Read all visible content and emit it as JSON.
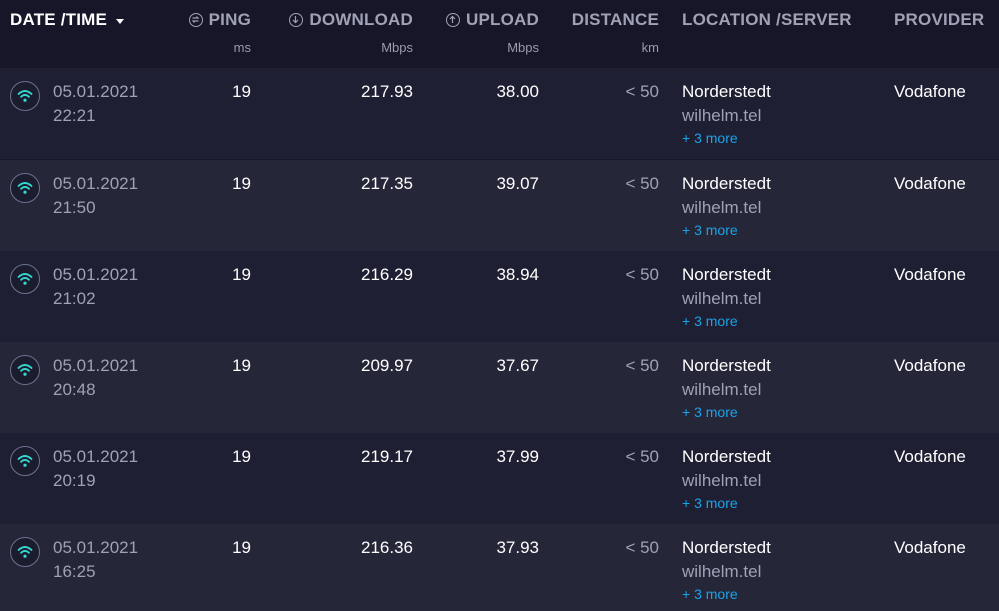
{
  "header": {
    "date_time": "DATE /TIME",
    "ping": "PING",
    "ping_unit": "ms",
    "download": "DOWNLOAD",
    "download_unit": "Mbps",
    "upload": "UPLOAD",
    "upload_unit": "Mbps",
    "distance": "DISTANCE",
    "distance_unit": "km",
    "location": "LOCATION /SERVER",
    "provider": "PROVIDER"
  },
  "rows": [
    {
      "date": "05.01.2021",
      "time": "22:21",
      "ping": "19",
      "download": "217.93",
      "upload": "38.00",
      "distance": "< 50",
      "location": "Norderstedt",
      "server": "wilhelm.tel",
      "more": "+ 3 more",
      "provider": "Vodafone"
    },
    {
      "date": "05.01.2021",
      "time": "21:50",
      "ping": "19",
      "download": "217.35",
      "upload": "39.07",
      "distance": "< 50",
      "location": "Norderstedt",
      "server": "wilhelm.tel",
      "more": "+ 3 more",
      "provider": "Vodafone"
    },
    {
      "date": "05.01.2021",
      "time": "21:02",
      "ping": "19",
      "download": "216.29",
      "upload": "38.94",
      "distance": "< 50",
      "location": "Norderstedt",
      "server": "wilhelm.tel",
      "more": "+ 3 more",
      "provider": "Vodafone"
    },
    {
      "date": "05.01.2021",
      "time": "20:48",
      "ping": "19",
      "download": "209.97",
      "upload": "37.67",
      "distance": "< 50",
      "location": "Norderstedt",
      "server": "wilhelm.tel",
      "more": "+ 3 more",
      "provider": "Vodafone"
    },
    {
      "date": "05.01.2021",
      "time": "20:19",
      "ping": "19",
      "download": "219.17",
      "upload": "37.99",
      "distance": "< 50",
      "location": "Norderstedt",
      "server": "wilhelm.tel",
      "more": "+ 3 more",
      "provider": "Vodafone"
    },
    {
      "date": "05.01.2021",
      "time": "16:25",
      "ping": "19",
      "download": "216.36",
      "upload": "37.93",
      "distance": "< 50",
      "location": "Norderstedt",
      "server": "wilhelm.tel",
      "more": "+ 3 more",
      "provider": "Vodafone"
    }
  ],
  "icons": {
    "connection": "wifi-icon",
    "ping": "ping-icon",
    "download": "download-icon",
    "upload": "upload-icon",
    "sort": "caret-down-icon"
  },
  "colors": {
    "background": "#161628",
    "row_odd": "#1f1f33",
    "row_even": "#262639",
    "accent": "#1aa3e8",
    "wifi": "#34d8d0"
  }
}
